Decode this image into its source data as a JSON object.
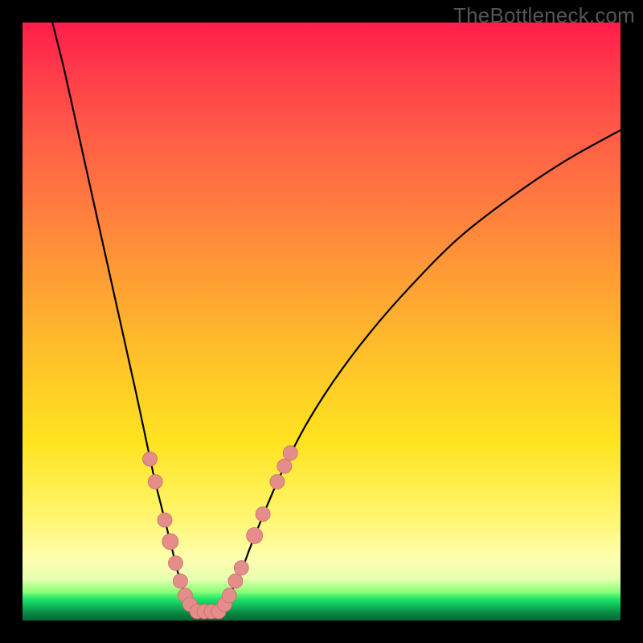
{
  "watermark": "TheBottleneck.com",
  "colors": {
    "bead_fill": "#e58d8a",
    "bead_stroke": "#c96f6a",
    "curve": "#000000",
    "frame": "#000000"
  },
  "chart_data": {
    "type": "line",
    "title": "",
    "xlabel": "",
    "ylabel": "",
    "xlim": [
      0,
      100
    ],
    "ylim": [
      0,
      100
    ],
    "note": "V-shaped curve on a vertical red→green gradient. Salmon beads mark ranges on both arms near the trough.",
    "series": [
      {
        "name": "left-arm",
        "x": [
          5,
          7,
          9,
          11,
          13,
          15,
          17,
          19,
          20.5,
          22,
          23.5,
          25,
          26,
          27,
          28,
          28.8
        ],
        "y": [
          100,
          92,
          83,
          74,
          65,
          56,
          47,
          38,
          31,
          24,
          18,
          12,
          8,
          5,
          3,
          1.5
        ]
      },
      {
        "name": "right-arm",
        "x": [
          33.2,
          34,
          35,
          36.5,
          38,
          40,
          43,
          47,
          52,
          58,
          65,
          73,
          82,
          91,
          100
        ],
        "y": [
          1.5,
          3,
          5,
          8,
          12,
          17,
          24,
          32,
          40,
          48,
          56,
          64,
          71,
          77,
          82
        ]
      },
      {
        "name": "floor",
        "x": [
          28.8,
          33.2
        ],
        "y": [
          1.5,
          1.5
        ]
      }
    ],
    "beads": {
      "left_arm": [
        {
          "x": 21.3,
          "y": 27.0,
          "r": 9
        },
        {
          "x": 22.2,
          "y": 23.2,
          "r": 9
        },
        {
          "x": 23.8,
          "y": 16.8,
          "r": 9
        },
        {
          "x": 24.7,
          "y": 13.2,
          "r": 10
        },
        {
          "x": 25.6,
          "y": 9.6,
          "r": 9
        },
        {
          "x": 26.4,
          "y": 6.6,
          "r": 9
        },
        {
          "x": 27.2,
          "y": 4.2,
          "r": 9
        },
        {
          "x": 28.0,
          "y": 2.7,
          "r": 9
        }
      ],
      "floor": [
        {
          "x": 29.2,
          "y": 1.5,
          "r": 9
        },
        {
          "x": 30.4,
          "y": 1.5,
          "r": 9
        },
        {
          "x": 31.6,
          "y": 1.5,
          "r": 9
        },
        {
          "x": 32.8,
          "y": 1.5,
          "r": 9
        }
      ],
      "right_arm": [
        {
          "x": 33.8,
          "y": 2.7,
          "r": 9
        },
        {
          "x": 34.6,
          "y": 4.2,
          "r": 9
        },
        {
          "x": 35.6,
          "y": 6.6,
          "r": 9
        },
        {
          "x": 36.6,
          "y": 8.8,
          "r": 9
        },
        {
          "x": 38.8,
          "y": 14.2,
          "r": 10
        },
        {
          "x": 40.2,
          "y": 17.8,
          "r": 9
        },
        {
          "x": 42.6,
          "y": 23.2,
          "r": 9
        },
        {
          "x": 43.8,
          "y": 25.8,
          "r": 9
        },
        {
          "x": 44.8,
          "y": 28.0,
          "r": 9
        }
      ]
    }
  }
}
